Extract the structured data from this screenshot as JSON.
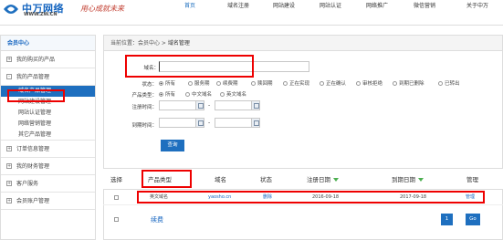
{
  "header": {
    "logo_name": "中万网络",
    "logo_url": "WWW.ZW.CN",
    "slogan": "用心成就未来",
    "nav": [
      "首页",
      "域名注册",
      "网站建设",
      "网站认证",
      "网络推广",
      "微信营销",
      "关于中万"
    ],
    "active_nav": "首页"
  },
  "sidebar": {
    "title": "会员中心",
    "groups": [
      {
        "label": "我的购买的产品",
        "sign": "+"
      },
      {
        "label": "我的产品管理",
        "sign": "-"
      }
    ],
    "subitems": [
      "域名产品管理",
      "网站建设管理",
      "网站认证管理",
      "网络营销管理",
      "其它产品管理"
    ],
    "selected_sub": "域名产品管理",
    "groups_after": [
      {
        "label": "订单信息管理",
        "sign": "+"
      },
      {
        "label": "我的财务管理",
        "sign": "+"
      },
      {
        "label": "客户服务",
        "sign": "+"
      },
      {
        "label": "会员账户管理",
        "sign": "+"
      }
    ]
  },
  "breadcrumb": {
    "prefix": "当前位置：会员中心 > ",
    "current": "域名管理"
  },
  "form": {
    "domain_label": "域名：",
    "domain_value": "",
    "status_label": "状态：",
    "status_options": [
      "所有",
      "服务期",
      "续费期",
      "赎回期",
      "正在实现",
      "正在确认",
      "审核拒绝",
      "到期已删除",
      "已转出"
    ],
    "status_selected": "所有",
    "type_label": "产品类型：",
    "type_options": [
      "所有",
      "中文域名",
      "英文域名"
    ],
    "type_selected": "所有",
    "reg_time_label": "注册时间：",
    "expire_time_label": "到期时间：",
    "range_separator": "-",
    "query_button": "查询"
  },
  "table": {
    "headers": [
      "选择",
      "产品类型",
      "域名",
      "状态",
      "注册日期",
      "到期日期",
      "管理"
    ],
    "rows": [
      {
        "type": "英文域名",
        "domain": "yaosho.cn",
        "status": "删除",
        "reg_date": "2016-09-18",
        "exp_date": "2017-09-18",
        "manage": "管理"
      }
    ],
    "renew_label": "续费",
    "page_number": "1",
    "go_label": "Go"
  },
  "colors": {
    "brand": "#1e6fbf",
    "annotation": "#ee0000",
    "sort_arrow": "#4caf50"
  }
}
